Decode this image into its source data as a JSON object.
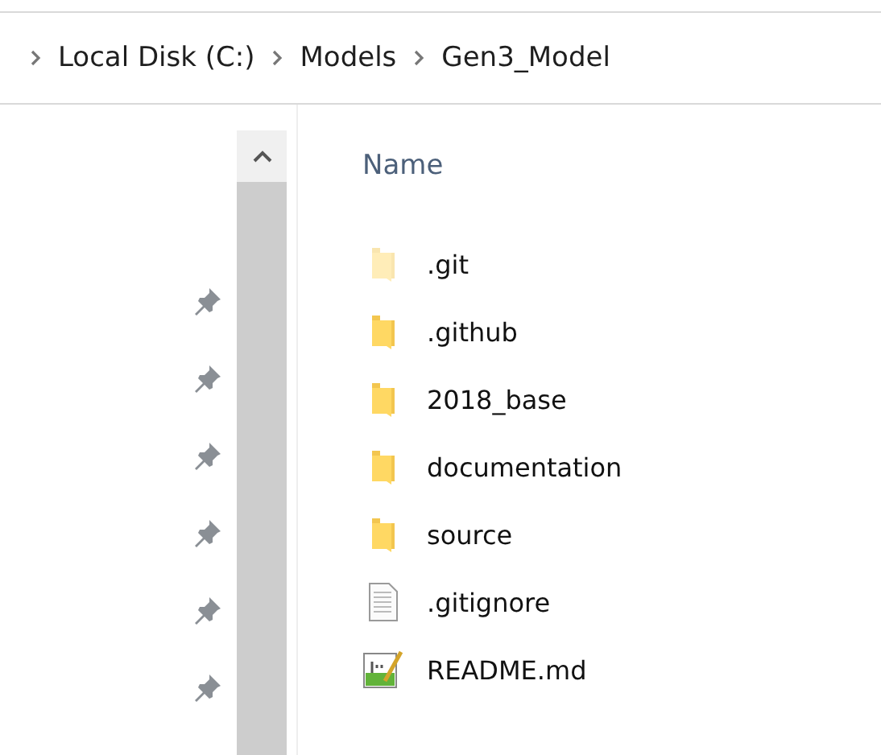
{
  "breadcrumb": [
    "Local Disk (C:)",
    "Models",
    "Gen3_Model"
  ],
  "quick_access": [
    {
      "pinned": true
    },
    {
      "pinned": true
    },
    {
      "pinned": true
    },
    {
      "pinned": true
    },
    {
      "pinned": true
    },
    {
      "pinned": true
    }
  ],
  "column_header": "Name",
  "files": [
    {
      "name": ".git",
      "kind": "folder",
      "hidden": true
    },
    {
      "name": ".github",
      "kind": "folder",
      "hidden": false
    },
    {
      "name": "2018_base",
      "kind": "folder",
      "hidden": false
    },
    {
      "name": "documentation",
      "kind": "folder",
      "hidden": false
    },
    {
      "name": "source",
      "kind": "folder",
      "hidden": false
    },
    {
      "name": ".gitignore",
      "kind": "text",
      "hidden": false
    },
    {
      "name": "README.md",
      "kind": "markdown",
      "hidden": false
    }
  ]
}
